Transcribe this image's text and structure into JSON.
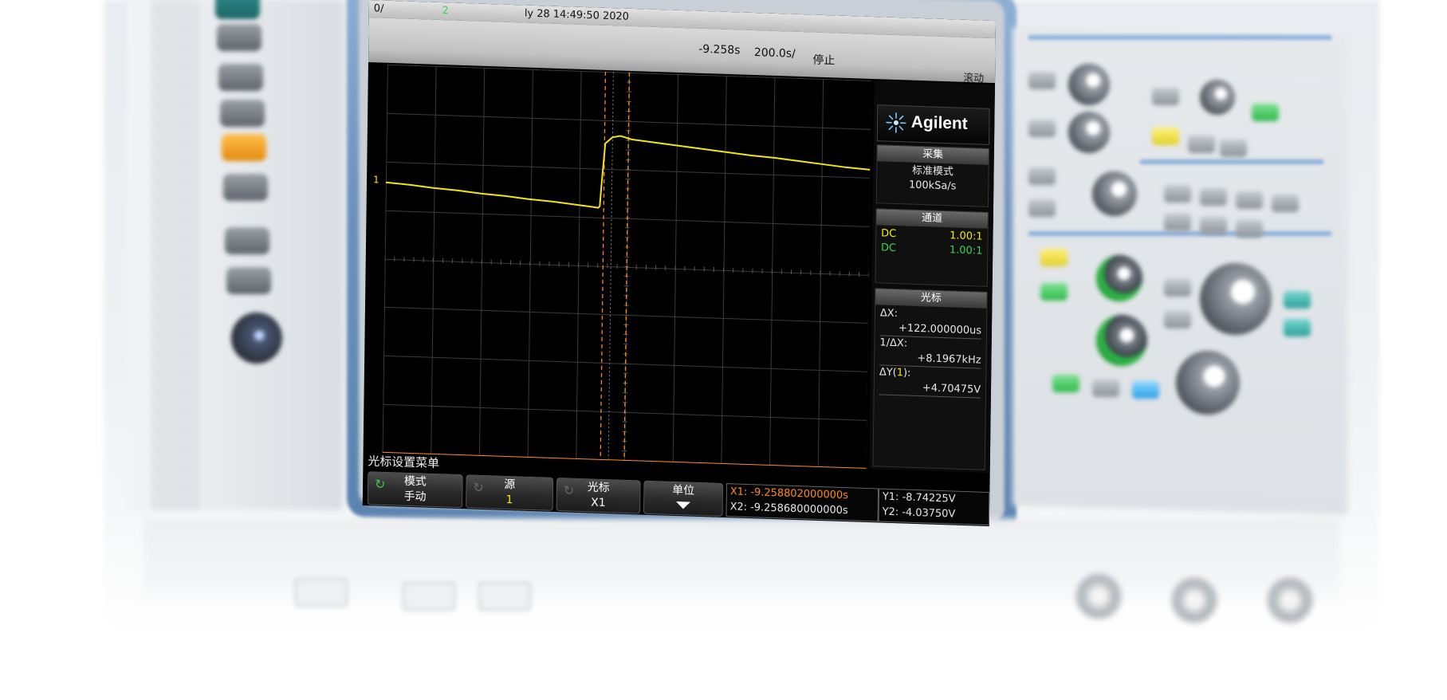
{
  "topbar": {
    "left_fragment": "0/",
    "channel_num": "2",
    "datetime": "ly 28 14:49:50 2020"
  },
  "status": {
    "time_offset": "-9.258s",
    "time_scale": "200.0s/",
    "run_state": "停止",
    "acq_mode": "滚动"
  },
  "brand": {
    "name": "Agilent"
  },
  "acquire": {
    "title": "采集",
    "mode": "标准模式",
    "rate": "100kSa/s"
  },
  "channels": {
    "title": "通道",
    "ch1": {
      "coupling": "DC",
      "probe": "1.00:1"
    },
    "ch2": {
      "coupling": "DC",
      "probe": "1.00:1"
    }
  },
  "cursors": {
    "title": "光标",
    "dx_label": "ΔX:",
    "dx_value": "+122.000000us",
    "inv_dx_label": "1/ΔX:",
    "inv_dx_value": "+8.1967kHz",
    "dy_label_prefix": "ΔY(",
    "dy_channel": "1",
    "dy_label_suffix": "):",
    "dy_value": "+4.70475V"
  },
  "markers": {
    "ch1": "1"
  },
  "menu": {
    "title": "光标设置菜单",
    "softkeys": [
      {
        "label": "模式",
        "value": "手动"
      },
      {
        "label": "源",
        "value": "1"
      },
      {
        "label": "光标",
        "value": "X1"
      },
      {
        "label": "单位",
        "value": ""
      }
    ]
  },
  "readout": {
    "x1": "X1: -9.258802000000s",
    "x2": "X2: -9.258680000000s",
    "y1": "Y1: -8.74225V",
    "y2": "Y2: -4.03750V"
  },
  "colors": {
    "trace_ch1": "#f2e614",
    "trace_ch2": "#34d64e",
    "cursor": "#ff8a1c",
    "grid": "#3c3c3c",
    "bezel": "#6e93bd"
  }
}
